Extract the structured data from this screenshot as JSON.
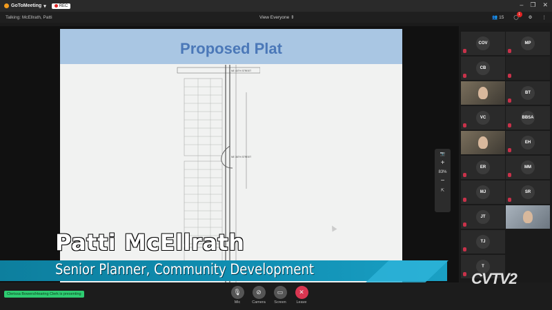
{
  "app": {
    "title": "GoToMeeting",
    "rec_label": "REC"
  },
  "header": {
    "talking": "Talking: McEllrath, Patti",
    "view_label": "View Everyone",
    "participants_count": "15",
    "chat_badge": "1"
  },
  "slide": {
    "title": "Proposed Plat",
    "plat_label_1": "NE 40TH STREET",
    "plat_label_2": "NE 36TH STREET"
  },
  "zoom": {
    "level": "83%"
  },
  "lower_third": {
    "name": "Patti McEllrath",
    "role": "Senior Planner, Community Development",
    "station_logo": "CVTV2"
  },
  "participants": [
    {
      "initials": "COV"
    },
    {
      "initials": "MP"
    },
    {
      "initials": "CB"
    },
    {
      "initials": ""
    },
    {
      "initials": ""
    },
    {
      "initials": "BT"
    },
    {
      "initials": "VC"
    },
    {
      "initials": "BBSA"
    },
    {
      "initials": ""
    },
    {
      "initials": "EH"
    },
    {
      "initials": "ER"
    },
    {
      "initials": "MM"
    },
    {
      "initials": "MJ"
    },
    {
      "initials": "SR"
    },
    {
      "initials": "JT"
    },
    {
      "initials": ""
    },
    {
      "initials": "TJ"
    },
    {
      "initials": "T"
    }
  ],
  "footer": {
    "presenting": "Clerissa Bowers/Hearing Clerk is presenting",
    "mic_label": "Mic",
    "camera_label": "Camera",
    "screen_label": "Screen",
    "leave_label": "Leave"
  }
}
